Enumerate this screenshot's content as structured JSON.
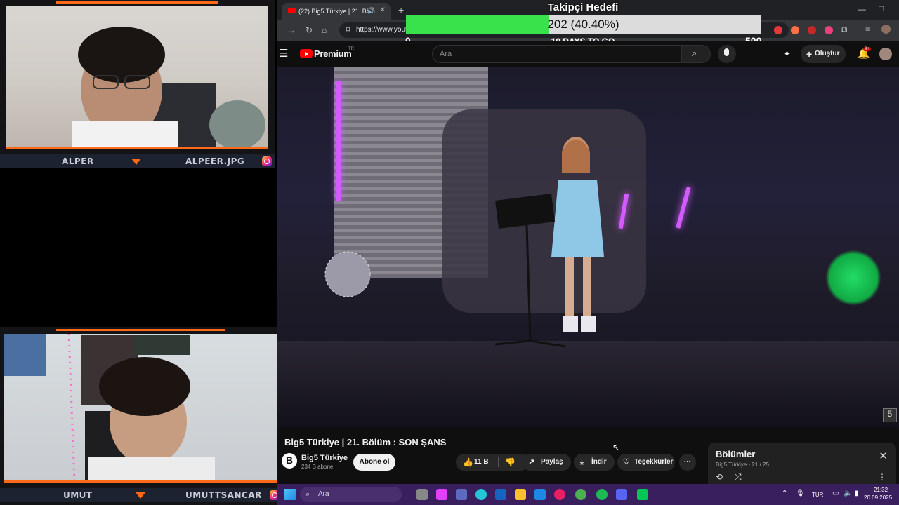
{
  "webcam_top": {
    "left_name": "ALPER",
    "right_name": "ALPEER.JPG"
  },
  "webcam_bottom": {
    "left_name": "UMUT",
    "right_name": "UMUTTSANCAR"
  },
  "goal": {
    "title": "Takipçi Hedefi",
    "progress_text": "202 (40.40%)",
    "current": 202,
    "target": 500,
    "percent": 40.4,
    "min_label": "0",
    "max_label": "500",
    "subtitle": "10 DAYS TO GO"
  },
  "browser": {
    "tab_title": "(22) Big5 Türkiye | 21. Bölü",
    "url": "https://www.yout",
    "new_tab": "+"
  },
  "youtube": {
    "logo_text": "Premium",
    "logo_sup": "TR",
    "search_placeholder": "Ara",
    "create_label": "Oluştur",
    "notif_count": "9+"
  },
  "video": {
    "title": "Big5 Türkiye | 21. Bölüm : SON ŞANS",
    "channel": "Big5 Türkiye",
    "subscribers": "234 B abone",
    "subscribe_label": "Abone ol",
    "likes": "11 B",
    "share_label": "Paylaş",
    "download_label": "İndir",
    "thanks_label": "Teşekkürler",
    "more_label": "···"
  },
  "chapters": {
    "title": "Bölümler",
    "subtitle": "Big5 Türkiye - 21 / 25"
  },
  "taskbar": {
    "search_placeholder": "Ara",
    "lang": "TUR",
    "time": "21:32",
    "date": "20.09.2025"
  },
  "colors": {
    "accent": "#ff6a1a",
    "goal_fill": "#39e14a",
    "yt_red": "#ff0000",
    "taskbar": "#3a1f5e"
  }
}
